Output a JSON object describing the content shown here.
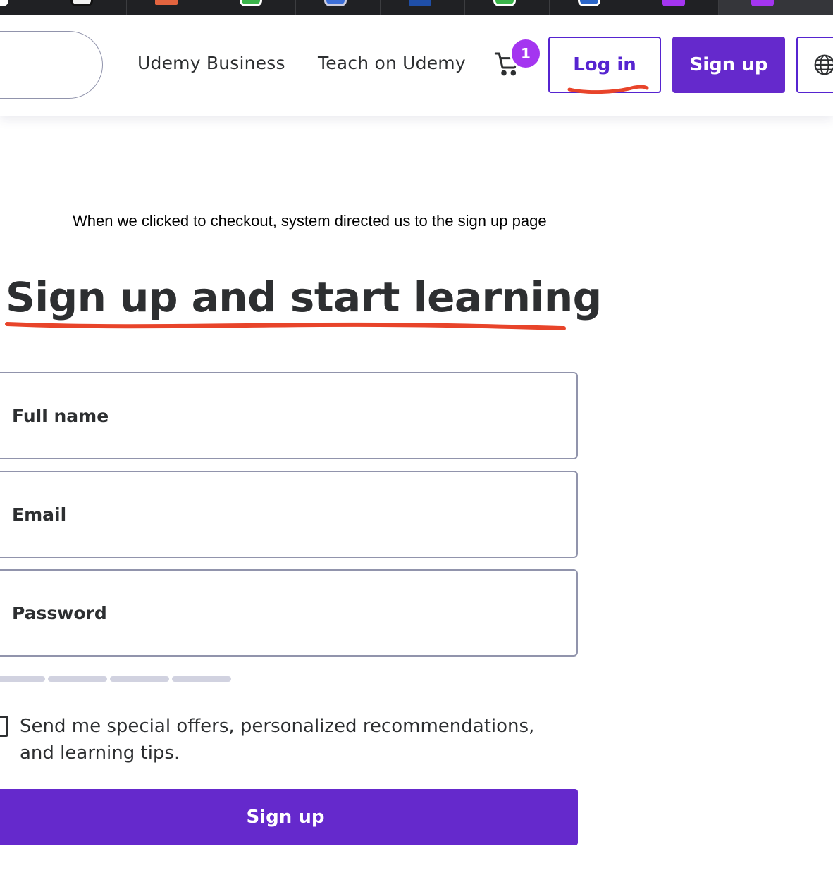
{
  "colors": {
    "brand_purple": "#6529cc",
    "link_purple": "#5624d0",
    "badge_purple": "#a435f0",
    "annotation_red": "#e8442a",
    "text_dark": "#2d2f31",
    "field_border": "#9194ac"
  },
  "header": {
    "nav": {
      "business_label": "Udemy Business",
      "teach_label": "Teach on Udemy"
    },
    "cart": {
      "icon": "cart-icon",
      "badge_count": "1"
    },
    "login_label": "Log in",
    "signup_label": "Sign up",
    "language_icon": "globe-icon"
  },
  "annotation": {
    "caption": "When we clicked to checkout, system directed us to the sign up page"
  },
  "form": {
    "title": "Sign up and start learning",
    "fields": [
      {
        "label": "Full name",
        "value": ""
      },
      {
        "label": "Email",
        "value": ""
      },
      {
        "label": "Password",
        "value": ""
      }
    ],
    "offers_label": "Send me special offers, personalized recommendations, and learning tips.",
    "offers_checked": false,
    "submit_label": "Sign up"
  }
}
